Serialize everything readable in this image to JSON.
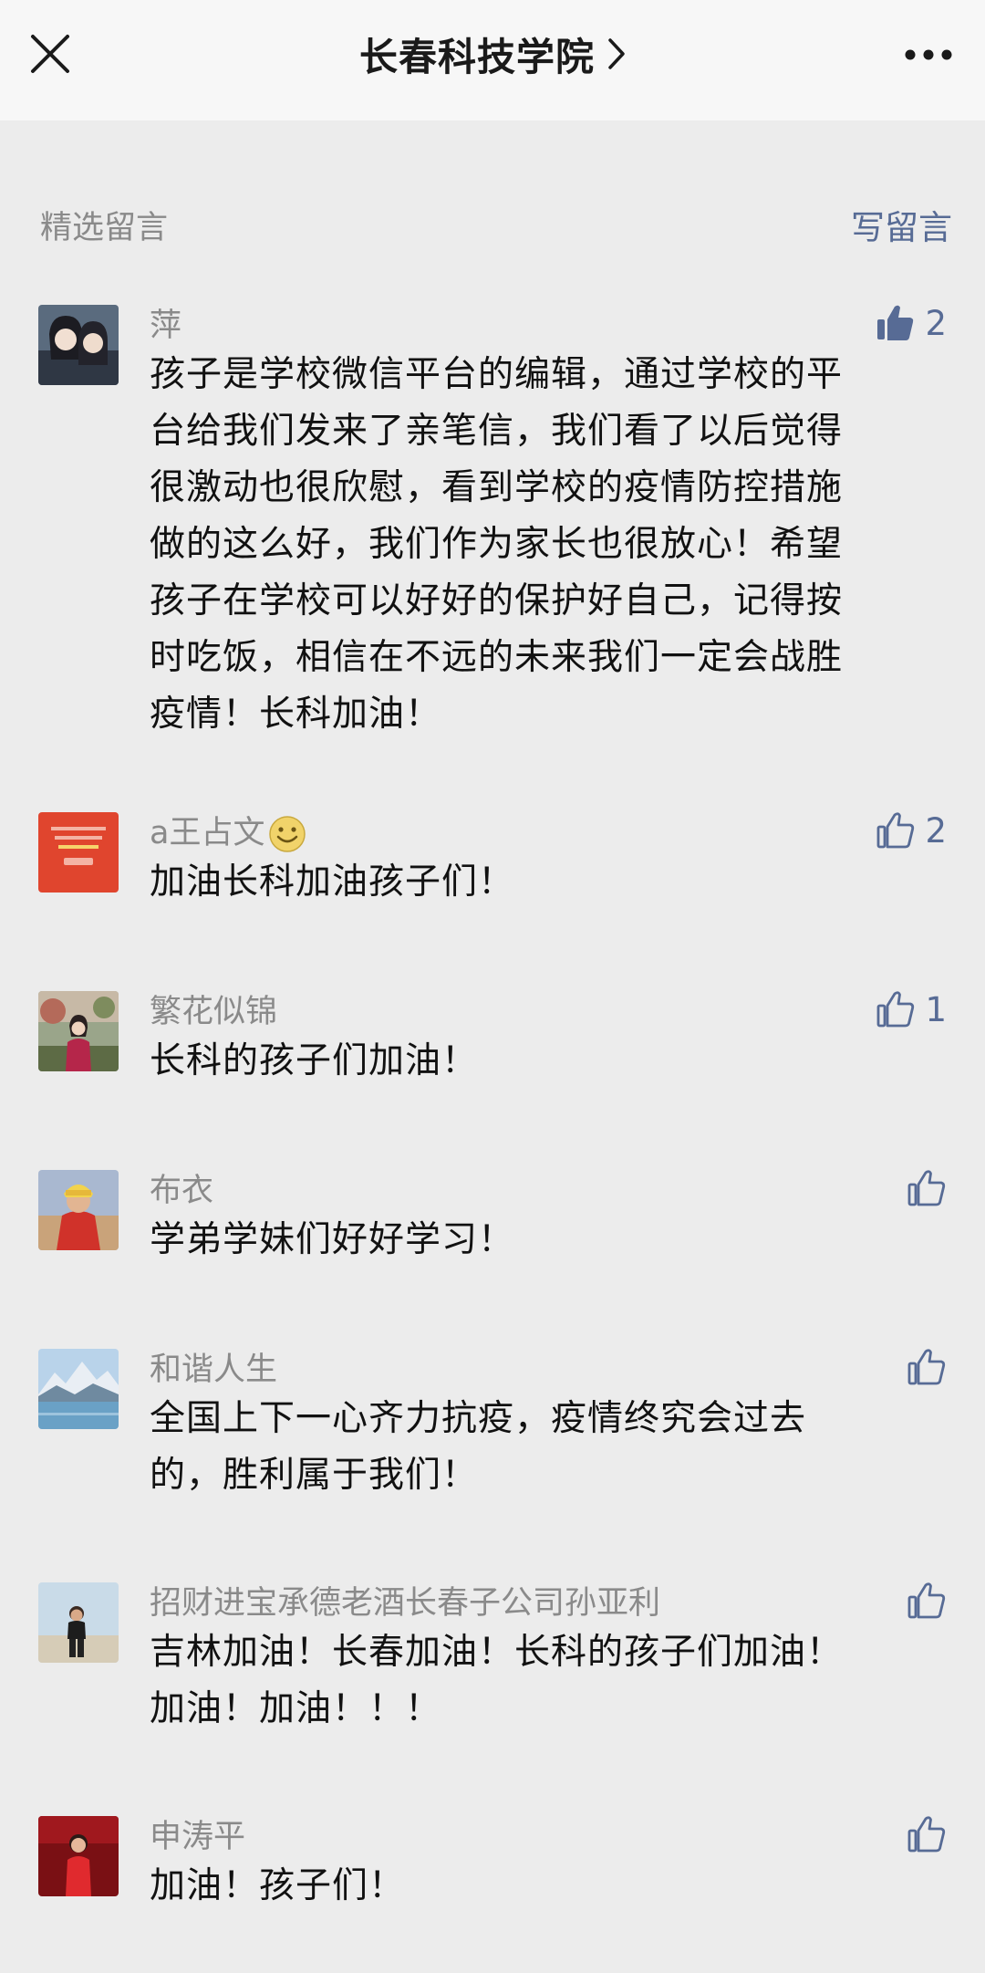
{
  "header": {
    "title": "长春科技学院",
    "close_icon": "close-icon",
    "more_icon": "more-icon"
  },
  "section": {
    "title": "精选留言",
    "write_label": "写留言"
  },
  "colors": {
    "link": "#576b95",
    "background": "#ececec",
    "header_bg": "#f7f7f7",
    "muted": "#8a8a8a"
  },
  "comments": [
    {
      "nickname": "萍",
      "likes": "2",
      "liked": true,
      "lines": [
        "孩子是学校微信平台的编辑，通过学校的平",
        "台给我们发来了亲笔信，我们看了以后觉得",
        "很激动也很欣慰，看到学校的疫情防控措施",
        "做的这么好，我们作为家长也很放心！希望",
        "孩子在学校可以好好的保护好自己，记得按",
        "时吃饭，相信在不远的未来我们一定会战胜",
        "疫情！长科加油！"
      ]
    },
    {
      "nickname": "a王占文",
      "nickname_emoji": "smiley-icon",
      "likes": "2",
      "liked": false,
      "lines": [
        "加油长科加油孩子们！"
      ]
    },
    {
      "nickname": "繁花似锦",
      "likes": "1",
      "liked": false,
      "lines": [
        "长科的孩子们加油！"
      ]
    },
    {
      "nickname": "布衣",
      "likes": "",
      "liked": false,
      "lines": [
        "学弟学妹们好好学习！"
      ]
    },
    {
      "nickname": "和谐人生",
      "likes": "",
      "liked": false,
      "lines": [
        "全国上下一心齐力抗疫，疫情终究会过去",
        "的，胜利属于我们！"
      ]
    },
    {
      "nickname": "招财进宝承德老酒长春子公司孙亚利",
      "likes": "",
      "liked": false,
      "lines": [
        "吉林加油！长春加油！长科的孩子们加油！",
        "加油！加油！！！"
      ]
    },
    {
      "nickname": "申涛平",
      "likes": "",
      "liked": false,
      "lines": [
        "加油！孩子们！"
      ]
    }
  ]
}
